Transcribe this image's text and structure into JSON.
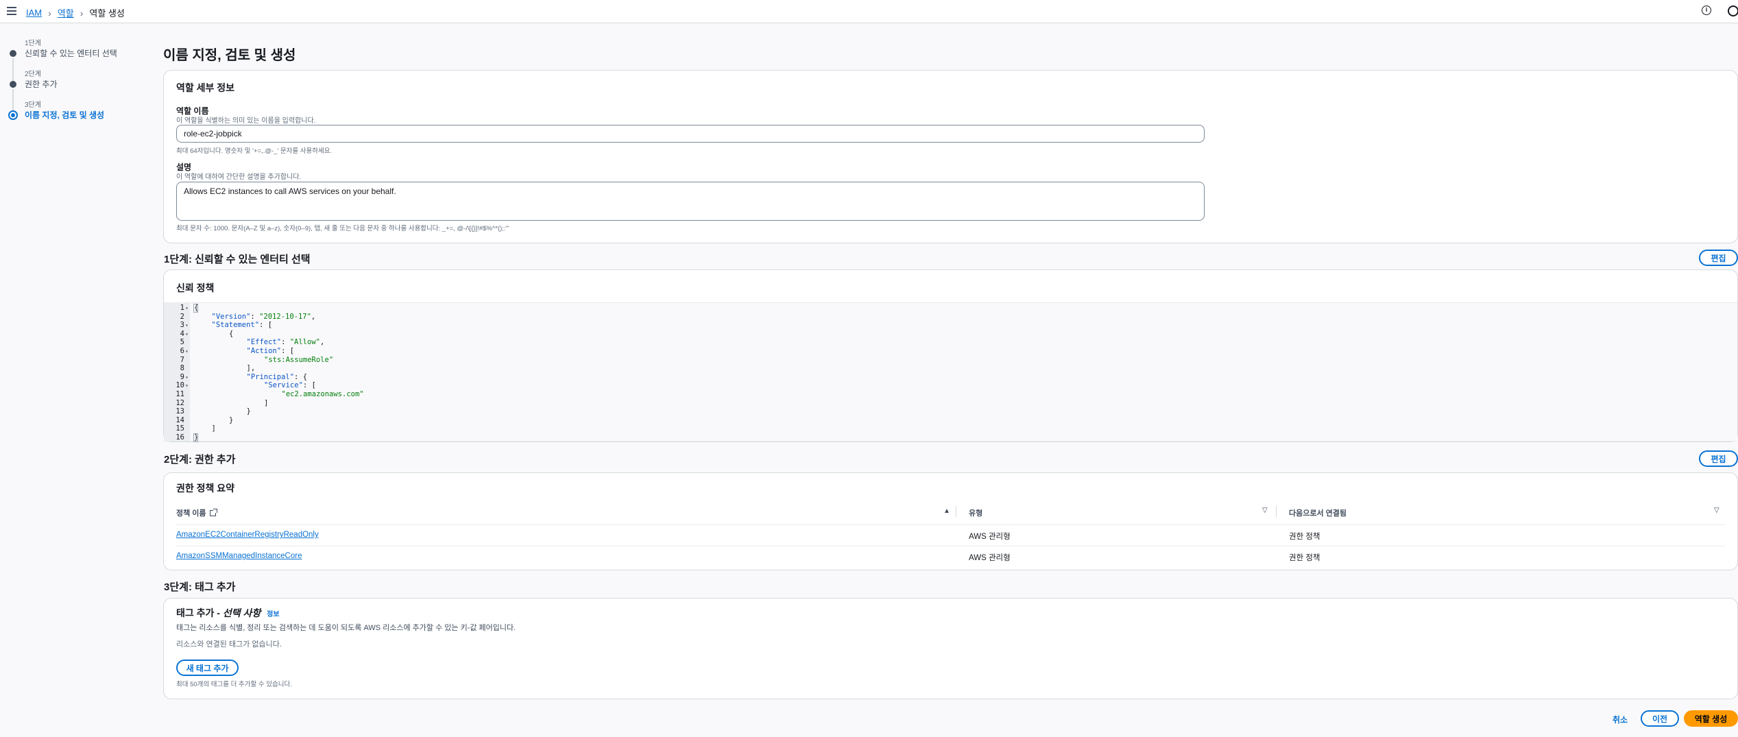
{
  "breadcrumb": {
    "items": [
      "IAM",
      "역할"
    ],
    "current": "역할 생성"
  },
  "steps": [
    {
      "num": "1단계",
      "label": "신뢰할 수 있는 엔터티 선택"
    },
    {
      "num": "2단계",
      "label": "권한 추가"
    },
    {
      "num": "3단계",
      "label": "이름 지정, 검토 및 생성"
    }
  ],
  "page_title": "이름 지정, 검토 및 생성",
  "role_details": {
    "heading": "역할 세부 정보",
    "name_label": "역할 이름",
    "name_desc": "이 역할을 식별하는 의미 있는 이름을 입력합니다.",
    "name_value": "role-ec2-jobpick",
    "name_hint": "최대 64자입니다. 영숫자 및 '+=,.@-_' 문자를 사용하세요.",
    "desc_label": "설명",
    "desc_desc": "이 역할에 대하여 간단한 설명을 추가합니다.",
    "desc_value": "Allows EC2 instances to call AWS services on your behalf.",
    "desc_hint": "최대 문자 수: 1000. 문자(A–Z 및 a–z), 숫자(0–9), 탭, 새 줄 또는 다음 문자 중 하나를 사용합니다: _+=, @-/\\[{}]!#$%^*();:'\""
  },
  "step1": {
    "title": "1단계: 신뢰할 수 있는 엔터티 선택",
    "edit": "편집",
    "panel_heading": "신뢰 정책",
    "code_lines": [
      {
        "n": "1",
        "fold": true,
        "indent": 0,
        "parts": [
          [
            "p",
            "{"
          ]
        ]
      },
      {
        "n": "2",
        "fold": false,
        "indent": 1,
        "parts": [
          [
            "k",
            "\"Version\""
          ],
          [
            "p",
            ": "
          ],
          [
            "s",
            "\"2012-10-17\""
          ],
          [
            "p",
            ","
          ]
        ]
      },
      {
        "n": "3",
        "fold": true,
        "indent": 1,
        "parts": [
          [
            "k",
            "\"Statement\""
          ],
          [
            "p",
            ": ["
          ]
        ]
      },
      {
        "n": "4",
        "fold": true,
        "indent": 2,
        "parts": [
          [
            "p",
            "{"
          ]
        ]
      },
      {
        "n": "5",
        "fold": false,
        "indent": 3,
        "parts": [
          [
            "k",
            "\"Effect\""
          ],
          [
            "p",
            ": "
          ],
          [
            "s",
            "\"Allow\""
          ],
          [
            "p",
            ","
          ]
        ]
      },
      {
        "n": "6",
        "fold": true,
        "indent": 3,
        "parts": [
          [
            "k",
            "\"Action\""
          ],
          [
            "p",
            ": ["
          ]
        ]
      },
      {
        "n": "7",
        "fold": false,
        "indent": 4,
        "parts": [
          [
            "s",
            "\"sts:AssumeRole\""
          ]
        ]
      },
      {
        "n": "8",
        "fold": false,
        "indent": 3,
        "parts": [
          [
            "p",
            "],"
          ]
        ]
      },
      {
        "n": "9",
        "fold": true,
        "indent": 3,
        "parts": [
          [
            "k",
            "\"Principal\""
          ],
          [
            "p",
            ": {"
          ]
        ]
      },
      {
        "n": "10",
        "fold": true,
        "indent": 4,
        "parts": [
          [
            "k",
            "\"Service\""
          ],
          [
            "p",
            ": ["
          ]
        ]
      },
      {
        "n": "11",
        "fold": false,
        "indent": 5,
        "parts": [
          [
            "s",
            "\"ec2.amazonaws.com\""
          ]
        ]
      },
      {
        "n": "12",
        "fold": false,
        "indent": 4,
        "parts": [
          [
            "p",
            "]"
          ]
        ]
      },
      {
        "n": "13",
        "fold": false,
        "indent": 3,
        "parts": [
          [
            "p",
            "}"
          ]
        ]
      },
      {
        "n": "14",
        "fold": false,
        "indent": 2,
        "parts": [
          [
            "p",
            "}"
          ]
        ]
      },
      {
        "n": "15",
        "fold": false,
        "indent": 1,
        "parts": [
          [
            "p",
            "]"
          ]
        ]
      },
      {
        "n": "16",
        "fold": false,
        "indent": 0,
        "parts": [
          [
            "p",
            "}"
          ]
        ]
      }
    ]
  },
  "step2": {
    "title": "2단계: 권한 추가",
    "edit": "편집",
    "panel_heading": "권한 정책 요약",
    "columns": [
      "정책 이름",
      "유형",
      "다음으로서 연결됨"
    ],
    "rows": [
      {
        "name": "AmazonEC2ContainerRegistryReadOnly",
        "type": "AWS 관리형",
        "attached": "권한 정책"
      },
      {
        "name": "AmazonSSMManagedInstanceCore",
        "type": "AWS 관리형",
        "attached": "권한 정책"
      }
    ]
  },
  "step3": {
    "title": "3단계: 태그 추가",
    "panel_heading": "태그 추가 - ",
    "panel_heading_em": "선택 사항",
    "info_link": "정보",
    "desc": "태그는 리소스를 식별, 정리 또는 검색하는 데 도움이 되도록 AWS 리소스에 추가할 수 있는 키-값 페어입니다.",
    "empty": "리소스와 연결된 태그가 없습니다.",
    "add_tag": "새 태그 추가",
    "hint": "최대 50개의 태그를 더 추가할 수 있습니다."
  },
  "footer": {
    "cancel": "취소",
    "previous": "이전",
    "create": "역할 생성"
  }
}
